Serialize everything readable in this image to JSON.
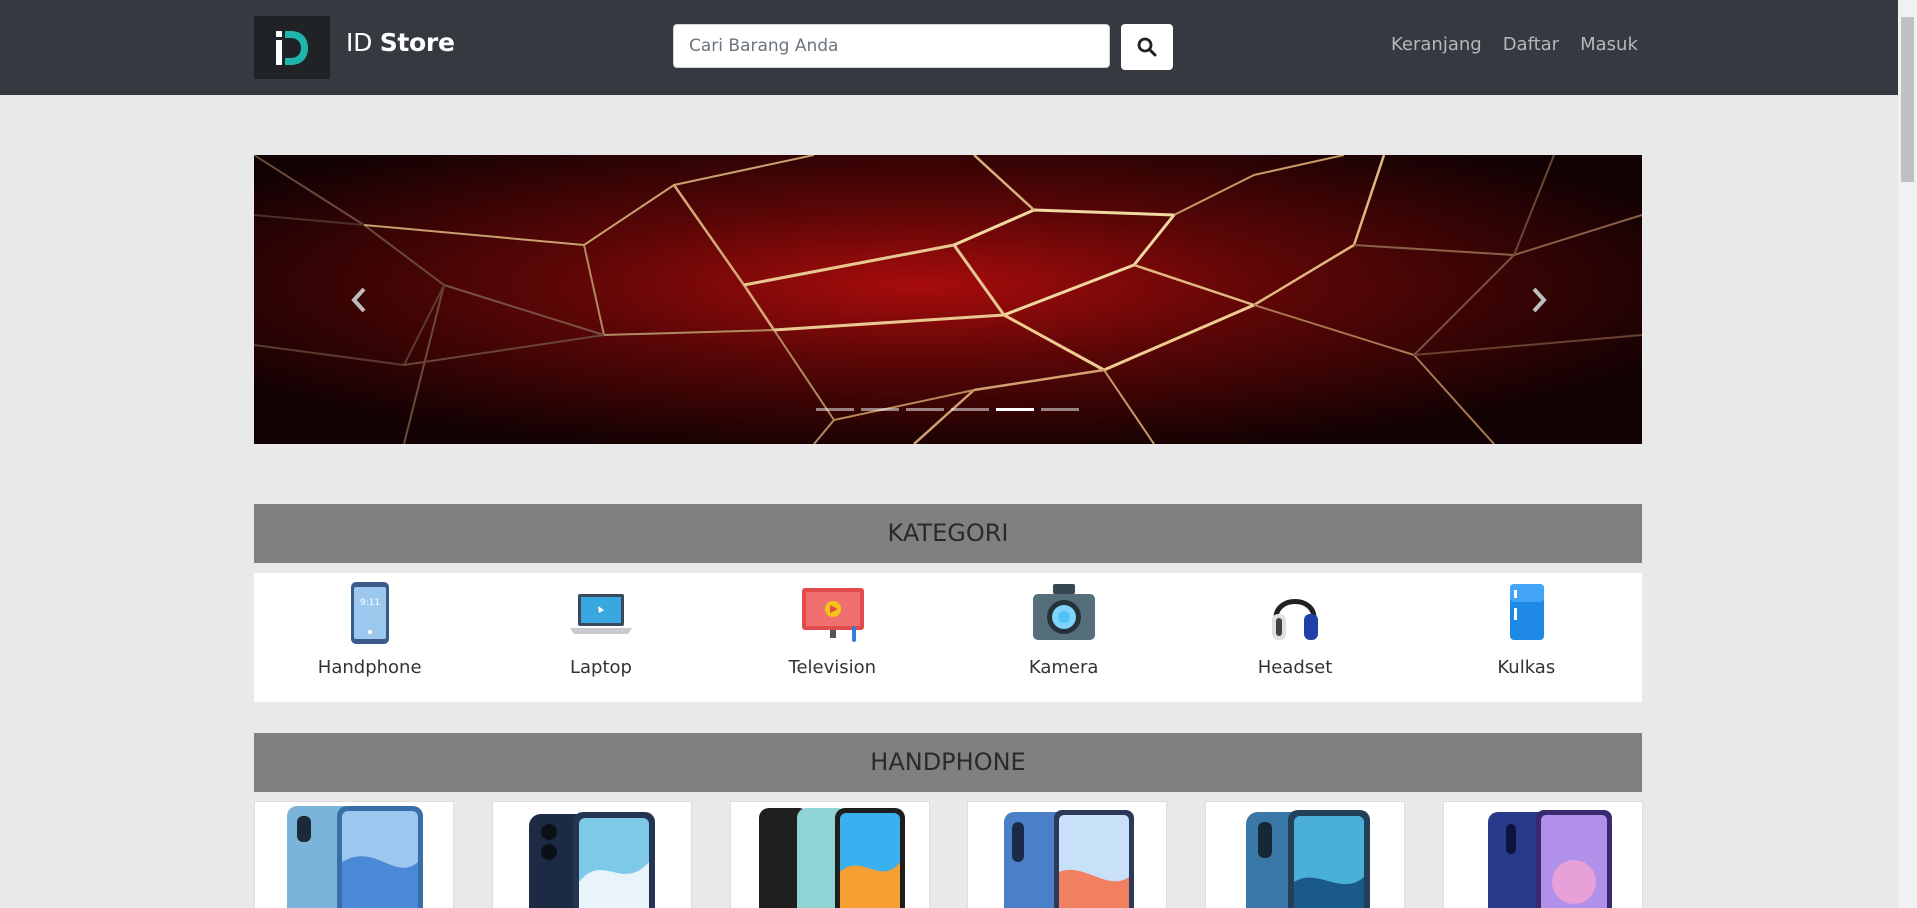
{
  "navbar": {
    "brand_light": "ID",
    "brand_bold": "Store",
    "search_placeholder": "Cari Barang Anda",
    "links": [
      "Keranjang",
      "Daftar",
      "Masuk"
    ]
  },
  "carousel": {
    "slide_count": 6,
    "active_index": 4
  },
  "sections": {
    "kategori": "KATEGORI",
    "handphone": "HANDPHONE"
  },
  "categories": [
    {
      "label": "Handphone",
      "icon": "smartphone-icon"
    },
    {
      "label": "Laptop",
      "icon": "laptop-icon"
    },
    {
      "label": "Television",
      "icon": "television-icon"
    },
    {
      "label": "Kamera",
      "icon": "camera-icon"
    },
    {
      "label": "Headset",
      "icon": "headset-icon"
    },
    {
      "label": "Kulkas",
      "icon": "refrigerator-icon"
    }
  ],
  "colors": {
    "navbar": "#343a40",
    "accent_teal": "#1fb5ad",
    "section_header": "#808080",
    "page_bg": "#e9e9e9"
  }
}
